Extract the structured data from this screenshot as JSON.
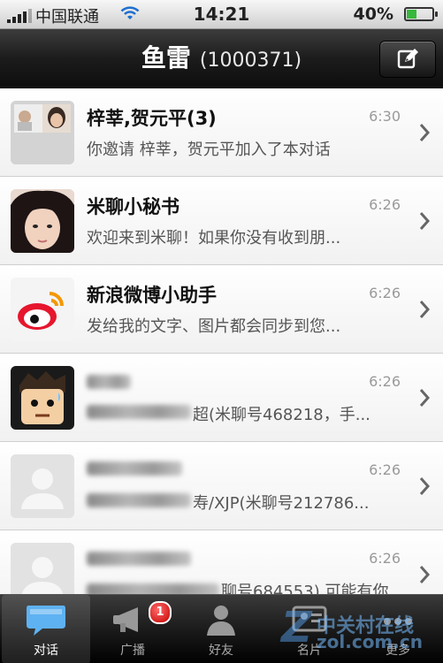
{
  "status_bar": {
    "carrier": "中国联通",
    "time": "14:21",
    "battery": "40%",
    "battery_level": 0.4
  },
  "nav": {
    "title": "鱼雷",
    "id_text": "(1000371)"
  },
  "conversations": [
    {
      "title": "梓莘,贺元平(3)",
      "time": "6:30",
      "preview": "你邀请 梓莘，贺元平加入了本对话",
      "avatar": "group-avatar"
    },
    {
      "title": "米聊小秘书",
      "time": "6:26",
      "preview": "欢迎来到米聊！如果你没有收到朋...",
      "avatar": "girl-photo-avatar"
    },
    {
      "title": "新浪微博小助手",
      "time": "6:26",
      "preview": "发给我的文字、图片都会同步到您...",
      "avatar": "weibo-logo-avatar"
    },
    {
      "title": "",
      "time": "6:26",
      "preview": "超(米聊号468218，手...",
      "avatar": "cartoon-avatar"
    },
    {
      "title": "",
      "time": "6:26",
      "preview": "寿/XJP(米聊号212786...",
      "avatar": "default-user-avatar"
    },
    {
      "title": "",
      "time": "6:26",
      "preview": "聊号684553) 可能有你",
      "avatar": "default-user-avatar"
    }
  ],
  "tabs": [
    {
      "label": "对话",
      "icon": "chat-bubble-icon"
    },
    {
      "label": "广播",
      "icon": "megaphone-icon",
      "badge": "1"
    },
    {
      "label": "好友",
      "icon": "contacts-icon"
    },
    {
      "label": "名片",
      "icon": "card-icon"
    },
    {
      "label": "更多",
      "icon": "more-icon"
    }
  ],
  "watermark": {
    "logo": "Z",
    "text1": "中关村在线",
    "text2": "zol.com.cn"
  }
}
